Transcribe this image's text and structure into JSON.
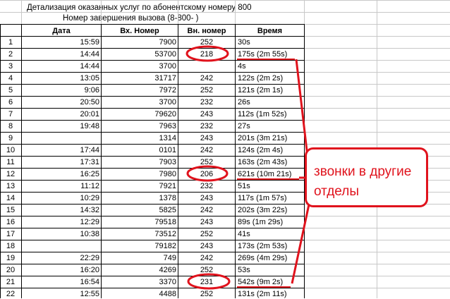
{
  "title_line1": "Детализация оказанных услуг по абонентскому номеру 800",
  "title_line2": "Номер завершения вызова  (8-800-                  )",
  "headers": [
    "",
    "Дата",
    "Вх. Номер",
    "Вн. номер",
    "Время"
  ],
  "rows": [
    {
      "n": "1",
      "date": "15:59",
      "in": "7900",
      "ext": "252",
      "time": "30s"
    },
    {
      "n": "2",
      "date": "14:44",
      "in": "53700",
      "ext": "218",
      "time": "175s (2m 55s)"
    },
    {
      "n": "3",
      "date": "14:44",
      "in": "3700",
      "ext": "",
      "time": "4s"
    },
    {
      "n": "4",
      "date": "13:05",
      "in": "31717",
      "ext": "242",
      "time": "122s (2m 2s)"
    },
    {
      "n": "5",
      "date": "9:06",
      "in": "7972",
      "ext": "252",
      "time": "121s (2m 1s)"
    },
    {
      "n": "6",
      "date": "20:50",
      "in": "3700",
      "ext": "232",
      "time": "26s"
    },
    {
      "n": "7",
      "date": "20:01",
      "in": "79620",
      "ext": "243",
      "time": "112s (1m 52s)"
    },
    {
      "n": "8",
      "date": "19:48",
      "in": "7963",
      "ext": "232",
      "time": "27s"
    },
    {
      "n": "9",
      "date": "",
      "in": "1314",
      "ext": "243",
      "time": "201s (3m 21s)"
    },
    {
      "n": "10",
      "date": "17:44",
      "in": "0101",
      "ext": "242",
      "time": "124s (2m 4s)"
    },
    {
      "n": "11",
      "date": "17:31",
      "in": "7903",
      "ext": "252",
      "time": "163s (2m 43s)"
    },
    {
      "n": "12",
      "date": "16:25",
      "in": "7980",
      "ext": "206",
      "time": "621s (10m 21s)"
    },
    {
      "n": "13",
      "date": "11:12",
      "in": "7921",
      "ext": "232",
      "time": "51s"
    },
    {
      "n": "14",
      "date": "10:29",
      "in": "1378",
      "ext": "243",
      "time": "117s (1m 57s)"
    },
    {
      "n": "15",
      "date": "14:32",
      "in": "5825",
      "ext": "242",
      "time": "202s (3m 22s)"
    },
    {
      "n": "16",
      "date": "12:29",
      "in": "79518",
      "ext": "243",
      "time": "89s (1m 29s)"
    },
    {
      "n": "17",
      "date": "10:38",
      "in": "73512",
      "ext": "252",
      "time": "41s"
    },
    {
      "n": "18",
      "date": "",
      "in": "79182",
      "ext": "243",
      "time": "173s (2m 53s)"
    },
    {
      "n": "19",
      "date": "22:29",
      "in": "749",
      "ext": "242",
      "time": "269s (4m 29s)"
    },
    {
      "n": "20",
      "date": "16:20",
      "in": "4269",
      "ext": "252",
      "time": "53s"
    },
    {
      "n": "21",
      "date": "16:54",
      "in": "3370",
      "ext": "231",
      "time": "542s (9m 2s)"
    },
    {
      "n": "22",
      "date": "12:55",
      "in": "4488",
      "ext": "252",
      "time": "131s (2m 11s)"
    }
  ],
  "annotation": {
    "text": "звонки в другие отделы",
    "color": "#e0131d"
  }
}
